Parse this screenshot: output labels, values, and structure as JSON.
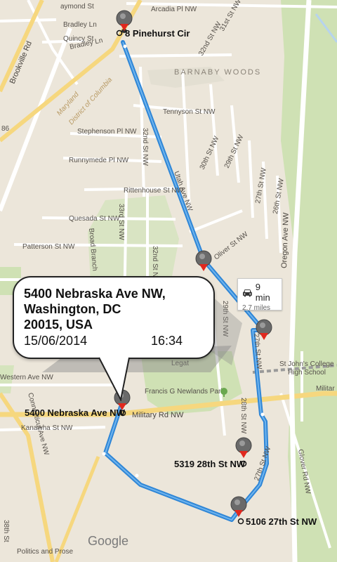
{
  "streets": {
    "raymond": "aymond St",
    "arcadia": "Arcadia Pl NW",
    "bradley_ln": "Bradley Ln",
    "bradley_ln2": "Bradley Ln",
    "quincy": "Quincy St",
    "brookville": "Brookville Rd",
    "st32_top": "32nd St NW",
    "st31_top": "31st St NW",
    "tennyson": "Tennyson St NW",
    "stephenson": "Stephenson Pl NW",
    "runnymede": "Runnymede Pl NW",
    "st32_mid": "32nd St NW",
    "st30": "30th St NW",
    "st29": "29th St NW",
    "rittenhouse": "Rittenhouse St NW",
    "utah": "Utah Ave NW",
    "quesada": "Quesada St NW",
    "st33": "33rd St NW",
    "patterson": "Patterson St NW",
    "broad_branch": "Broad Branch",
    "st27": "27th St NW",
    "st26": "26th St NW",
    "oliver": "Oliver St NW",
    "oregon": "Oregon Ave NW",
    "western": "Western Ave NW",
    "connecticut": "Connecticut Ave NW",
    "kanawha": "Kanawha St NW",
    "military": "Military Rd NW",
    "military_right": "Militar",
    "st27_route": "27th St NW",
    "st28": "28th St NW",
    "st27_lower": "27th St NW",
    "glover": "Glover Rd NW",
    "st38": "38th St",
    "legation": "Legat",
    "st29_right": "29th St NW",
    "rt86": "86"
  },
  "places": {
    "barnaby_woods": "BARNABY WOODS",
    "maryland": "Maryland",
    "dc": "District of Columbia",
    "newlands_park": "Francis G Newlands Park",
    "st_johns": "St John's College",
    "st_johns2": "High School",
    "politics_prose": "Politics and Prose"
  },
  "stops": [
    {
      "label": "8 Pinehurst Cir"
    },
    {
      "label": "5400 Nebraska Ave NW"
    },
    {
      "label": "5319 28th St NW"
    },
    {
      "label": "5106 27th St NW"
    }
  ],
  "info_bubble": {
    "address_line1": "5400 Nebraska Ave NW,",
    "address_line2": "Washington, DC",
    "address_line3": "20015, USA",
    "date": "15/06/2014",
    "time": "16:34"
  },
  "eta": {
    "time": "9 min",
    "distance": "2.7 miles",
    "icon": "car-icon"
  },
  "attribution": {
    "brand": "Google"
  },
  "colors": {
    "route": "#2f86d6",
    "map_bg": "#ece6da",
    "park": "#cfe1b4",
    "road_major": "#f6d77e"
  }
}
